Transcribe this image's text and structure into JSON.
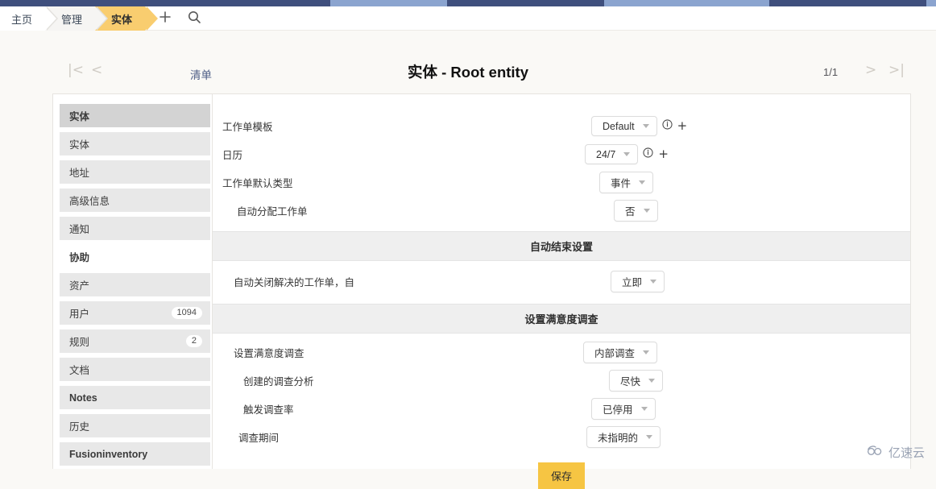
{
  "topbar": {
    "segments": [
      "segment-a",
      "segment-b",
      "segment-c"
    ]
  },
  "nav": {
    "crumbs": [
      {
        "label": "主页",
        "active": false
      },
      {
        "label": "管理",
        "active": false
      },
      {
        "label": "实体",
        "active": true
      }
    ],
    "add_icon": "plus-icon",
    "search_icon": "search-icon"
  },
  "subheader": {
    "first_label": "|<",
    "prev_label": "<",
    "next_label": ">",
    "last_label": ">|",
    "list_link": "清单",
    "title": "实体 - Root entity",
    "pager": "1/1"
  },
  "sidebar": {
    "items": [
      {
        "label": "实体",
        "style": "head",
        "badge": ""
      },
      {
        "label": "实体",
        "style": "normal",
        "badge": ""
      },
      {
        "label": "地址",
        "style": "normal",
        "badge": ""
      },
      {
        "label": "高级信息",
        "style": "normal",
        "badge": ""
      },
      {
        "label": "通知",
        "style": "normal",
        "badge": ""
      },
      {
        "label": "协助",
        "style": "active",
        "badge": ""
      },
      {
        "label": "资产",
        "style": "normal",
        "badge": ""
      },
      {
        "label": "用户",
        "style": "normal",
        "badge": "1094"
      },
      {
        "label": "规则",
        "style": "normal",
        "badge": "2"
      },
      {
        "label": "文档",
        "style": "normal",
        "badge": ""
      },
      {
        "label": "Notes",
        "style": "bold-lbl",
        "badge": ""
      },
      {
        "label": "历史",
        "style": "normal",
        "badge": ""
      },
      {
        "label": "Fusioninventory",
        "style": "bold-lbl",
        "badge": ""
      }
    ]
  },
  "form": {
    "rows": [
      {
        "label": "工作单模板",
        "value": "Default",
        "info": true,
        "plus": true,
        "indent": false
      },
      {
        "label": "日历",
        "value": "24/7",
        "info": true,
        "plus": true,
        "indent": false
      },
      {
        "label": "工作单默认类型",
        "value": "事件",
        "info": false,
        "plus": false,
        "indent": false
      },
      {
        "label": "自动分配工作单",
        "value": "否",
        "info": false,
        "plus": false,
        "indent": false
      }
    ],
    "section_auto_close": "自动结束设置",
    "row_auto_close": {
      "label": "自动关闭解决的工作单，自",
      "value": "立即"
    },
    "section_survey": "设置满意度调查",
    "survey_rows": [
      {
        "label": "设置满意度调查",
        "value": "内部调查",
        "indent": false
      },
      {
        "label": "创建的调查分析",
        "value": "尽快",
        "indent": true
      },
      {
        "label": "触发调查率",
        "value": "已停用",
        "indent": true
      },
      {
        "label": "调查期间",
        "value": "未指明的",
        "indent": true
      }
    ],
    "save_label": "保存"
  },
  "watermark": {
    "text": "亿速云",
    "icon": "cloud-logo-icon"
  },
  "colors": {
    "accent": "#f9cd6f",
    "save": "#f6c543",
    "topbar": "#3f4f7d",
    "topbar_light": "#8ba4cf",
    "link": "#4c5c85"
  }
}
